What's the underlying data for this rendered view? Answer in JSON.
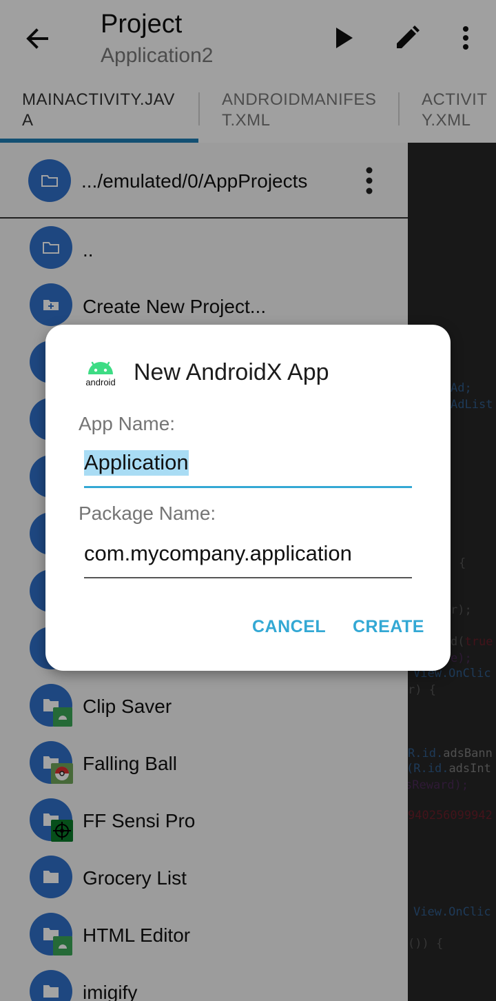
{
  "appbar": {
    "title": "Project",
    "subtitle": "Application2"
  },
  "tabs": [
    {
      "label": "MAINACTIVITY.JAVA",
      "active": true
    },
    {
      "label": "ANDROIDMANIFEST.XML",
      "active": false
    },
    {
      "label": "ACTIVITY.XML",
      "active": false
    }
  ],
  "drawer": {
    "path": ".../emulated/0/AppProjects",
    "items": [
      {
        "label": "..",
        "icon": "folder-icon"
      },
      {
        "label": "Create New Project...",
        "icon": "folder-add-icon"
      },
      {
        "label": "Clip Saver",
        "icon": "folder-icon",
        "badge": "android-badge-icon"
      },
      {
        "label": "Falling Ball",
        "icon": "folder-icon",
        "badge": "pokeball-badge-icon"
      },
      {
        "label": "FF Sensi Pro",
        "icon": "folder-icon",
        "badge": "crosshair-badge-icon"
      },
      {
        "label": "Grocery List",
        "icon": "folder-icon"
      },
      {
        "label": "HTML Editor",
        "icon": "folder-icon",
        "badge": "android-badge-icon"
      },
      {
        "label": "imigify",
        "icon": "folder-icon"
      }
    ]
  },
  "code_fragments": {
    "l1": "Ad;",
    "l2": "AdList",
    "l3": "{",
    "l4": "r);",
    "l5a": "d(",
    "l5b": "true",
    "l6": "e);",
    "l7": "View.OnClic",
    "l8": "r) {",
    "l9a": "R.",
    "l9b": "id.",
    "l9c": "adsBann",
    "l10a": "(R.",
    "l10b": "id.",
    "l10c": "adsInt",
    "l11": "sReward);",
    "l12": "940256099942",
    "l13": "View.OnClic",
    "l14": "()) {"
  },
  "dialog": {
    "title": "New AndroidX App",
    "logo_text": "android",
    "app_name_label": "App Name:",
    "app_name_value": "Application",
    "package_name_label": "Package Name:",
    "package_name_value": "com.mycompany.application",
    "cancel": "CANCEL",
    "create": "CREATE"
  },
  "colors": {
    "accent": "#33a8d4",
    "folder_circle": "#2f6fc8",
    "tab_indicator": "#1f7eb5",
    "android_green": "#3ddc84"
  }
}
